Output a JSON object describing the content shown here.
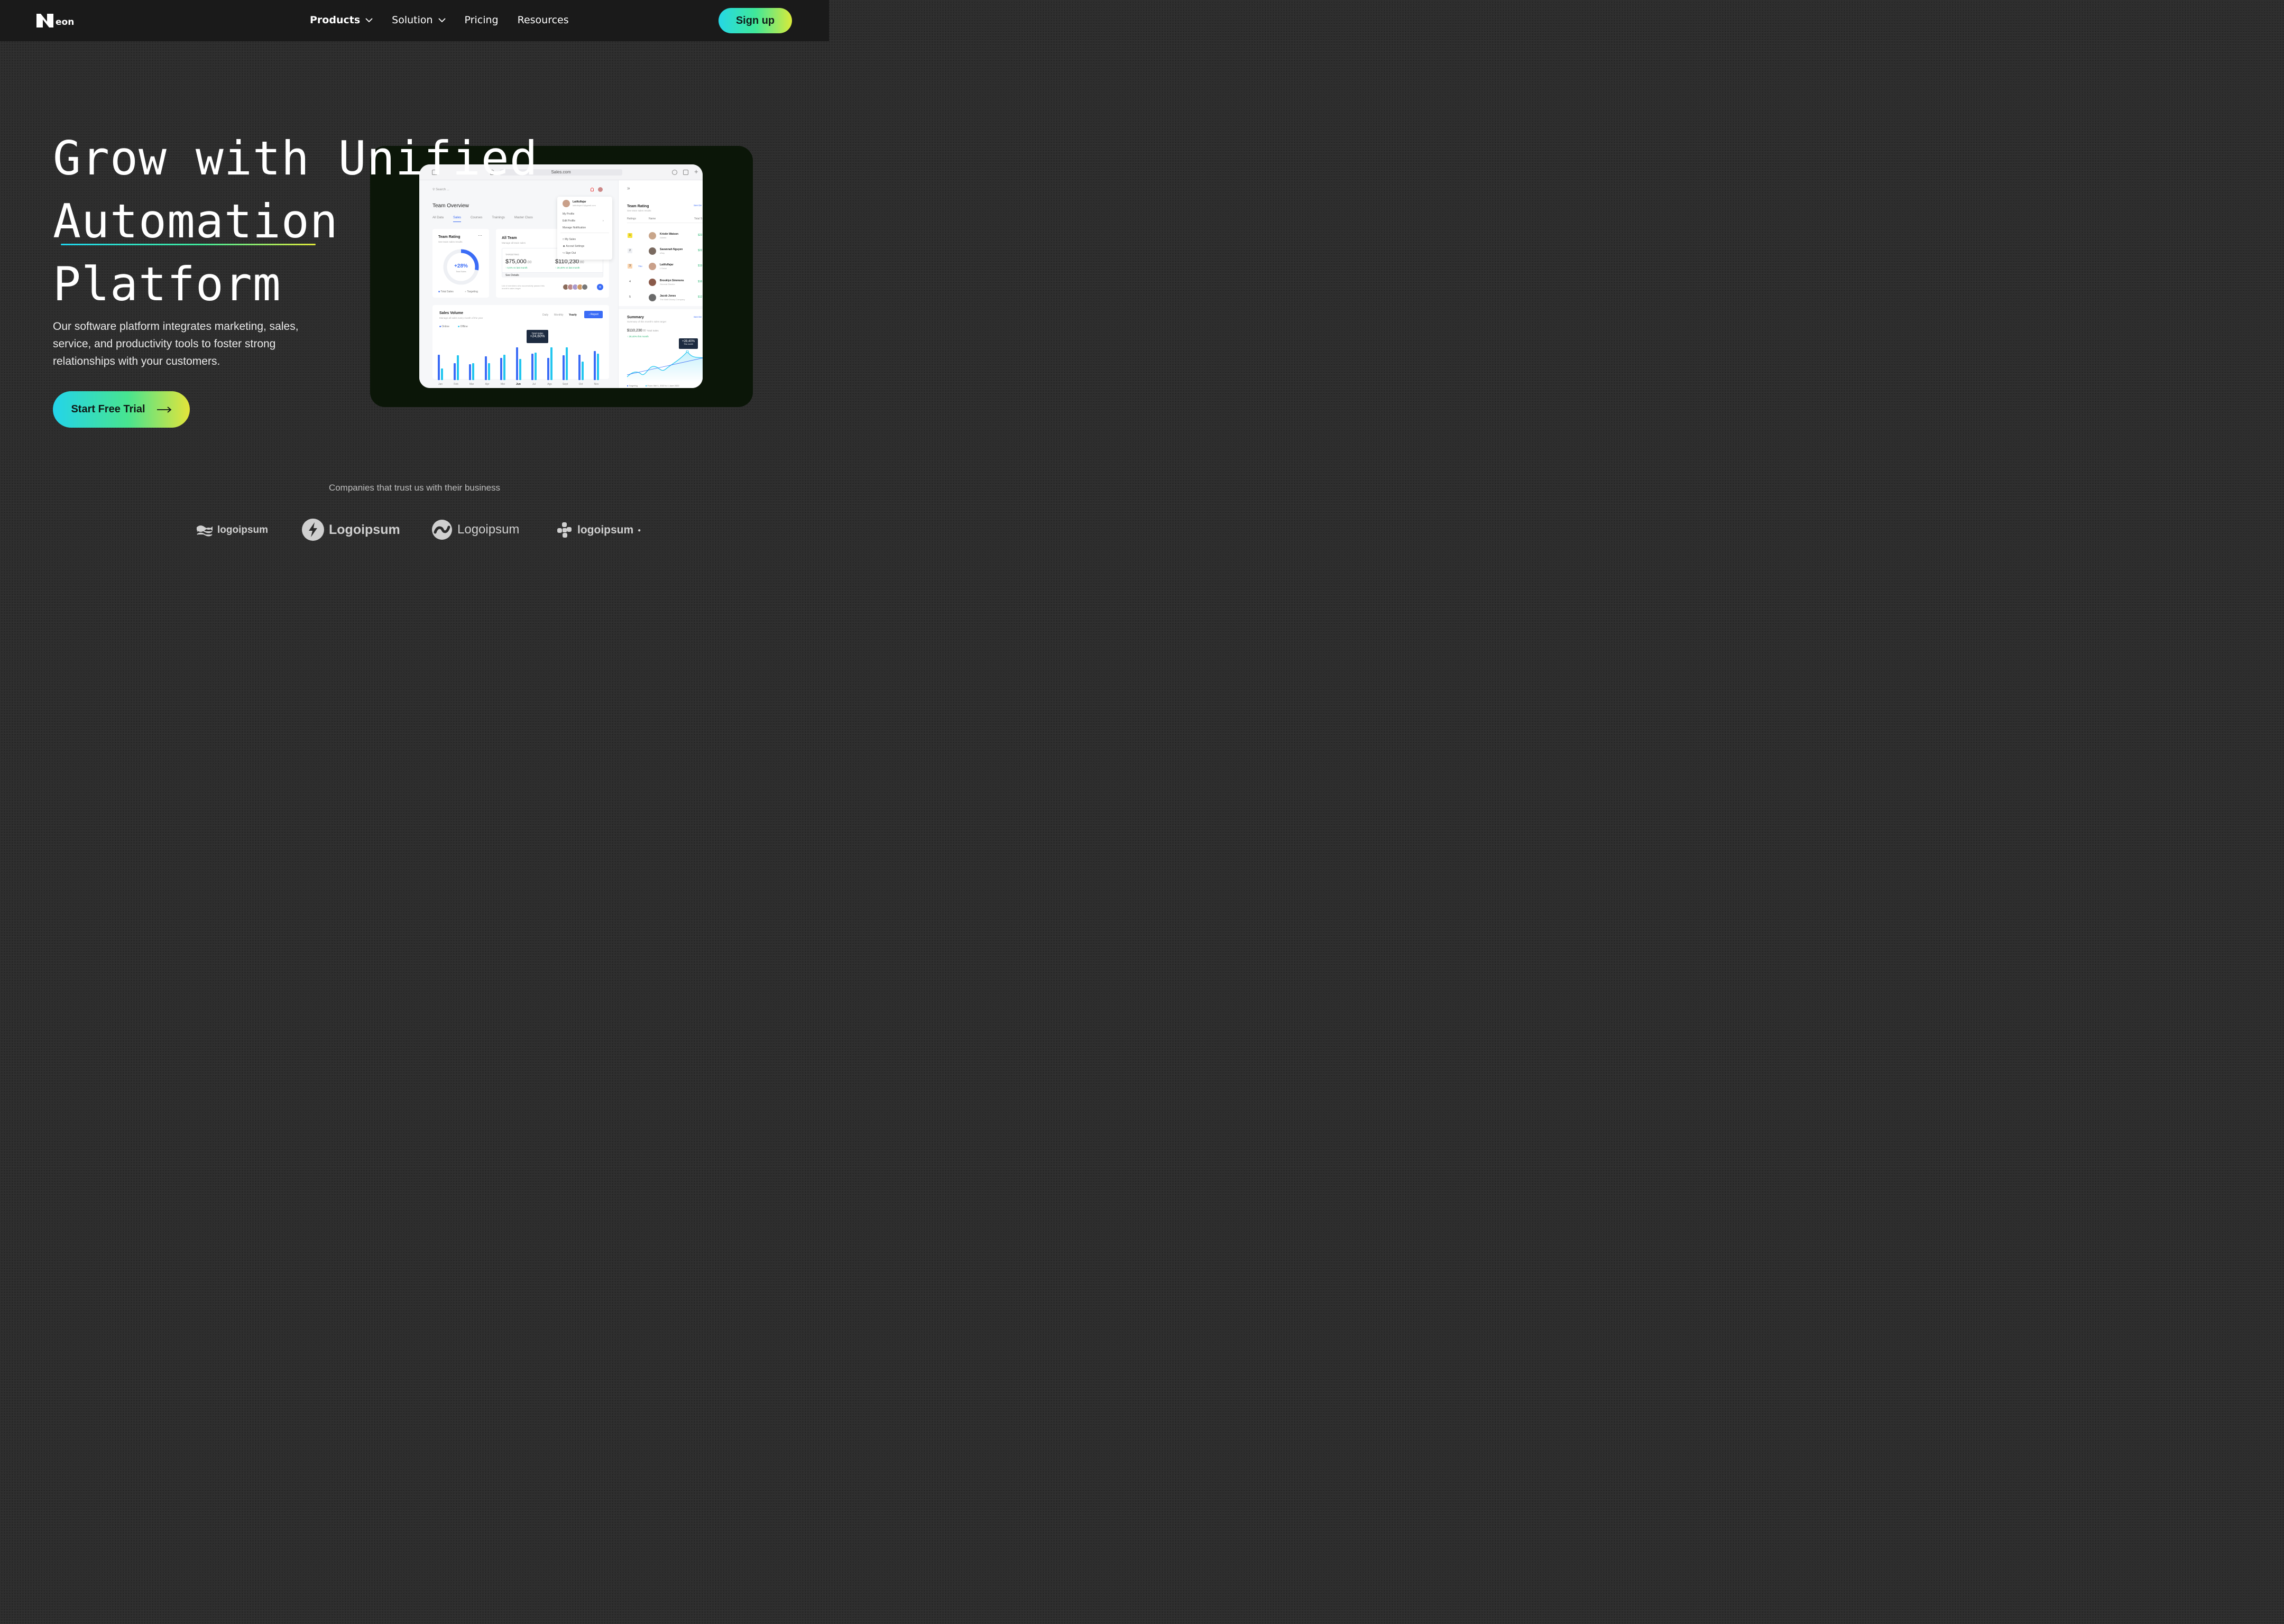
{
  "nav": {
    "logo_text": "eon",
    "items": [
      {
        "label": "Products",
        "has_dropdown": true
      },
      {
        "label": "Solution",
        "has_dropdown": true
      },
      {
        "label": "Pricing",
        "has_dropdown": false
      },
      {
        "label": "Resources",
        "has_dropdown": false
      }
    ],
    "signup_label": "Sign up"
  },
  "hero": {
    "title_lines": [
      "Grow with Unified",
      "Automation",
      "Platform"
    ],
    "description": "Our software platform integrates marketing, sales, service, and productivity tools to foster strong relationships with your customers.",
    "cta_label": "Start Free Trial"
  },
  "dashboard": {
    "url": "Sales.com",
    "search_placeholder": "Search ...",
    "title": "Team Overview",
    "tabs": [
      "All Data",
      "Sales",
      "Courses",
      "Trainings",
      "Master Class"
    ],
    "team_rating": {
      "title": "Team Rating",
      "subtitle": "See team sales results",
      "percent": "+28%",
      "center_label": "Total Sales",
      "legend": [
        "Total Sales",
        "Targeting"
      ],
      "ring_fraction": 0.28
    },
    "all_team": {
      "title": "All Team",
      "subtitle": "Manage all team sales",
      "targeting_label": "TARGETING",
      "targeting_value": "$75,000",
      "targeting_cents": ".00",
      "targeting_delta": "5,5% vs last month",
      "total_value": "$110,230",
      "total_cents": ".80",
      "total_delta": "28,40% vs last month",
      "details": "See Details",
      "members_note": "List of members who successfully passed this month's sales target"
    },
    "profile_menu": {
      "name": "Latifulfajar",
      "email": "latifulfajar12@gmail.com",
      "items": [
        "My Profile",
        "Edit Profile",
        "Manage Notification",
        "My Sales",
        "Accout Settings",
        "Sign Out"
      ]
    },
    "sales_volume": {
      "title": "Sales Volume",
      "subtitle": "Manage all sales every month of the year",
      "periods": [
        "Daily",
        "Monthly",
        "Yearly"
      ],
      "report": "Report",
      "legend": [
        "Online",
        "Offline"
      ],
      "tooltip_label": "Total Sales",
      "tooltip_value": "+24,60%"
    },
    "side": {
      "title": "Team Rating",
      "subtitle": "See team sales results",
      "see_details": "See De",
      "columns": [
        "Ratings",
        "Name",
        "Total S"
      ],
      "you_label": "You",
      "rows": [
        {
          "rank": "1",
          "name": "Kristin Watson",
          "company": "Gillette",
          "value": "$23"
        },
        {
          "rank": "2",
          "name": "Savannah Nguyen",
          "company": "eBay",
          "value": "$22"
        },
        {
          "rank": "3",
          "name": "Latifulfajar",
          "company": "L'Oréal",
          "value": "$19"
        },
        {
          "rank": "4",
          "name": "Brooklyn Simmons",
          "company": "General Electric",
          "value": "$16"
        },
        {
          "rank": "5",
          "name": "Jacob Jones",
          "company": "The Walt Disney Company",
          "value": "$12"
        }
      ],
      "summary_title": "Summary",
      "summary_sub": "Summary of this month's sales target",
      "summary_value": "$110,230",
      "summary_cents": ".80",
      "summary_value_label": "Total Sales",
      "summary_delta": "28,40% this month",
      "summary_tip": "+28,40%",
      "summary_tip_sub": "This month",
      "summary_legend": [
        "Targeting",
        "From: Mei 1, 2022 to 1 June 2022"
      ]
    }
  },
  "chart_data": {
    "type": "bar",
    "categories": [
      "Jan",
      "Feb",
      "Mar",
      "Apr",
      "Mei",
      "Jun",
      "Jul",
      "Ags",
      "Sept",
      "Oct",
      "Nov"
    ],
    "series": [
      {
        "name": "Online",
        "values": [
          48,
          32,
          30,
          45,
          42,
          62,
          50,
          42,
          47,
          48,
          55
        ]
      },
      {
        "name": "Offline",
        "values": [
          22,
          47,
          32,
          32,
          48,
          40,
          52,
          62,
          62,
          35,
          50
        ]
      }
    ],
    "ylim": [
      0,
      65
    ],
    "highlight_category": "Jun"
  },
  "trust": {
    "heading": "Companies that trust us with their business",
    "logos": [
      "logoipsum",
      "Logoipsum",
      "Logoipsum",
      "logoipsum"
    ]
  },
  "colors": {
    "accent_start": "#25d7e6",
    "accent_mid": "#3fe89a",
    "accent_end": "#d9ea3a",
    "showcase_bg": "#0b1608",
    "chart_blue": "#3b6cf6",
    "chart_cyan": "#23c6ef"
  }
}
